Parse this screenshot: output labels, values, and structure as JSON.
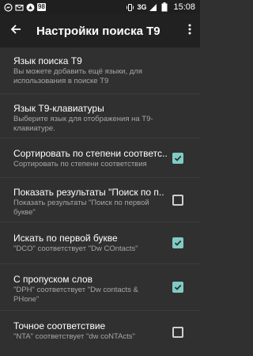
{
  "status_bar": {
    "notification_badge": "98",
    "network_label": "3G",
    "time": "15:08",
    "icons": [
      "messenger-icon",
      "mail-icon",
      "email-app-icon",
      "vibrate-icon",
      "signal-icon",
      "battery-icon"
    ]
  },
  "app_bar": {
    "title": "Настройки поиска Т9",
    "back_icon": "arrow-back-icon",
    "menu_icon": "overflow-menu-icon"
  },
  "settings": [
    {
      "title": "Язык поиска Т9",
      "subtitle": "Вы можете добавить ещё языки, для использования в поиске Т9",
      "checkbox": null
    },
    {
      "title": "Язык T9-клавиатуры",
      "subtitle": "Выберите язык для отображения на Т9-клавиатуре.",
      "checkbox": null
    },
    {
      "title": "Сортировать по степени соответс..",
      "subtitle": "Сортировать по степени соответствия",
      "checkbox": true
    },
    {
      "title": "Показать результаты \"Поиск по п..",
      "subtitle": "Показать результаты \"Поиск по первой букве\"",
      "checkbox": false
    },
    {
      "title": "Искать по первой букве",
      "subtitle": "\"DCO\" соответствует \"Dw COntacts\"",
      "checkbox": true
    },
    {
      "title": "С пропуском слов",
      "subtitle": "\"DPH\" соответствует \"Dw contacts & PHone\"",
      "checkbox": true
    },
    {
      "title": "Точное соответствие",
      "subtitle": "\"NTA\" соответствует \"dw coNTActs\"",
      "checkbox": false
    }
  ],
  "colors": {
    "background": "#303030",
    "app_bar": "#212121",
    "status_bar": "#1f1f1f",
    "checkbox_checked": "#80cbc4",
    "subtitle_text": "#a7a7a7"
  }
}
